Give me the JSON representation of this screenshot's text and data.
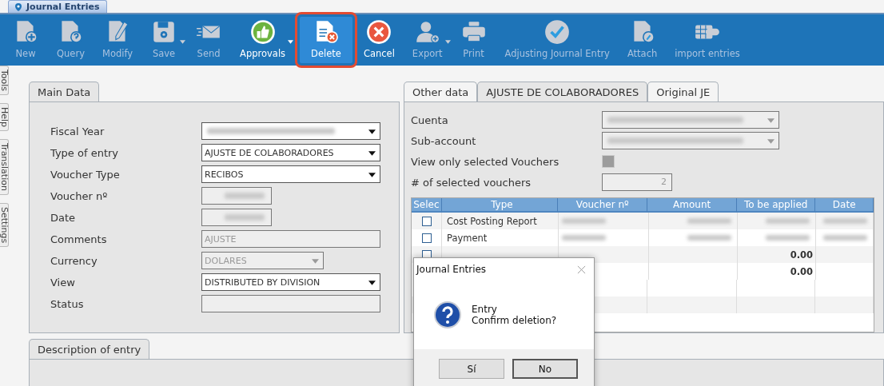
{
  "window_tab": {
    "title": "Journal Entries"
  },
  "toolbar": [
    {
      "label": "New",
      "enabled": false,
      "selected": false,
      "annotated": false,
      "dropdown": false
    },
    {
      "label": "Query",
      "enabled": false,
      "selected": false,
      "annotated": false,
      "dropdown": false
    },
    {
      "label": "Modify",
      "enabled": false,
      "selected": false,
      "annotated": false,
      "dropdown": false
    },
    {
      "label": "Save",
      "enabled": false,
      "selected": false,
      "annotated": false,
      "dropdown": true
    },
    {
      "label": "Send",
      "enabled": false,
      "selected": false,
      "annotated": false,
      "dropdown": false
    },
    {
      "label": "Approvals",
      "enabled": true,
      "selected": false,
      "annotated": false,
      "dropdown": true
    },
    {
      "label": "Delete",
      "enabled": true,
      "selected": true,
      "annotated": true,
      "dropdown": false
    },
    {
      "label": "Cancel",
      "enabled": true,
      "selected": false,
      "annotated": false,
      "dropdown": false
    },
    {
      "label": "Export",
      "enabled": false,
      "selected": false,
      "annotated": false,
      "dropdown": true
    },
    {
      "label": "Print",
      "enabled": false,
      "selected": false,
      "annotated": false,
      "dropdown": false
    },
    {
      "label": "Adjusting Journal Entry",
      "enabled": false,
      "selected": false,
      "annotated": false,
      "dropdown": false
    },
    {
      "label": "Attach",
      "enabled": false,
      "selected": false,
      "annotated": false,
      "dropdown": false
    },
    {
      "label": "import entries",
      "enabled": false,
      "selected": false,
      "annotated": false,
      "dropdown": false
    }
  ],
  "side_tabs": [
    "Tools",
    "Help",
    "Translation",
    "Settings"
  ],
  "main_data": {
    "tab": "Main Data",
    "fields": [
      {
        "label": "Fiscal Year",
        "kind": "combo",
        "disabled": false,
        "blurred": true
      },
      {
        "label": "Type of entry",
        "kind": "combo",
        "disabled": false,
        "blurred": false,
        "value": "AJUSTE DE COLABORADORES"
      },
      {
        "label": "Voucher Type",
        "kind": "combo",
        "disabled": false,
        "blurred": false,
        "value": "RECIBOS"
      },
      {
        "label": "Voucher nº",
        "kind": "short-text",
        "disabled": true,
        "blurred": true
      },
      {
        "label": "Date",
        "kind": "short-text",
        "disabled": true,
        "blurred": true
      },
      {
        "label": "Comments",
        "kind": "text",
        "disabled": true,
        "blurred": false,
        "value": "AJUSTE"
      },
      {
        "label": "Currency",
        "kind": "short-combo",
        "disabled": true,
        "blurred": false,
        "value": "DOLARES"
      },
      {
        "label": "View",
        "kind": "combo",
        "disabled": false,
        "blurred": false,
        "value": "DISTRIBUTED BY DIVISION"
      },
      {
        "label": "Status",
        "kind": "text",
        "disabled": true,
        "blurred": false
      }
    ]
  },
  "right_panel": {
    "tabs": [
      {
        "label": "Other data",
        "selected": false
      },
      {
        "label": "AJUSTE DE COLABORADORES",
        "selected": true
      },
      {
        "label": "Original JE",
        "selected": false
      }
    ],
    "fields": [
      {
        "label": "Cuenta",
        "kind": "combo",
        "blurred": true
      },
      {
        "label": "Sub-account",
        "kind": "combo",
        "blurred": true
      },
      {
        "label": "View only selected Vouchers",
        "kind": "checkbox",
        "checked": false
      },
      {
        "label": "# of selected vouchers",
        "kind": "number",
        "value": "2"
      }
    ],
    "table": {
      "columns": [
        "Selec",
        "Type",
        "Voucher nº",
        "Amount",
        "To be applied",
        "Date"
      ],
      "rows": [
        {
          "checked": false,
          "type": "Cost Posting Report",
          "blurred": true
        },
        {
          "checked": false,
          "type": "Payment",
          "blurred": true
        },
        {
          "checked": false,
          "blurred": false,
          "to_be_applied": "0.00"
        },
        {
          "blurred": false,
          "to_be_applied": "0.00"
        }
      ]
    }
  },
  "description": {
    "tab": "Description of entry"
  },
  "dialog": {
    "title": "Journal Entries",
    "lines": [
      "Entry",
      "Confirm deletion?"
    ],
    "buttons": [
      {
        "label": "Sí",
        "selected": false
      },
      {
        "label": "No",
        "selected": true
      }
    ]
  }
}
